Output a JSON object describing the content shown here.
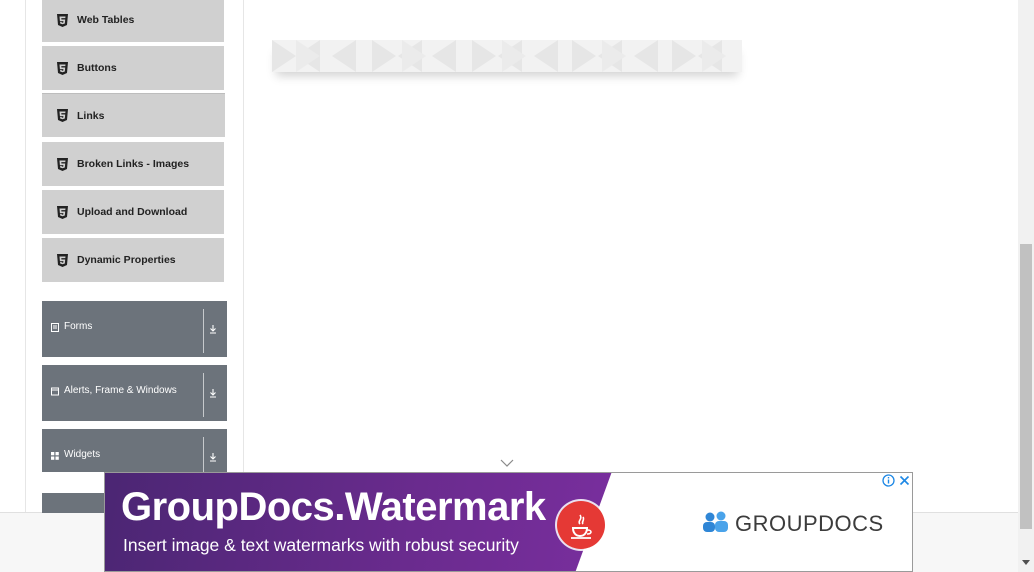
{
  "sidebar": {
    "elements_items": [
      {
        "label": "Web Tables"
      },
      {
        "label": "Buttons"
      },
      {
        "label": "Links"
      },
      {
        "label": "Broken Links - Images"
      },
      {
        "label": "Upload and Download"
      },
      {
        "label": "Dynamic Properties"
      }
    ],
    "groups": [
      {
        "label": "Forms",
        "icon": "form-icon"
      },
      {
        "label": "Alerts, Frame & Windows",
        "icon": "window-icon"
      },
      {
        "label": "Widgets",
        "icon": "grid-icon"
      }
    ]
  },
  "ad": {
    "title": "GroupDocs.Watermark",
    "subtitle": "Insert image & text watermarks with robust security",
    "brand": "GROUPDOCS",
    "colors": {
      "purple": "#6a2b8e",
      "java_red": "#e53935",
      "brand_blue": "#2f86d6"
    }
  },
  "colors": {
    "sub_item_bg": "#d0d0d0",
    "group_bg": "#6c737b"
  }
}
